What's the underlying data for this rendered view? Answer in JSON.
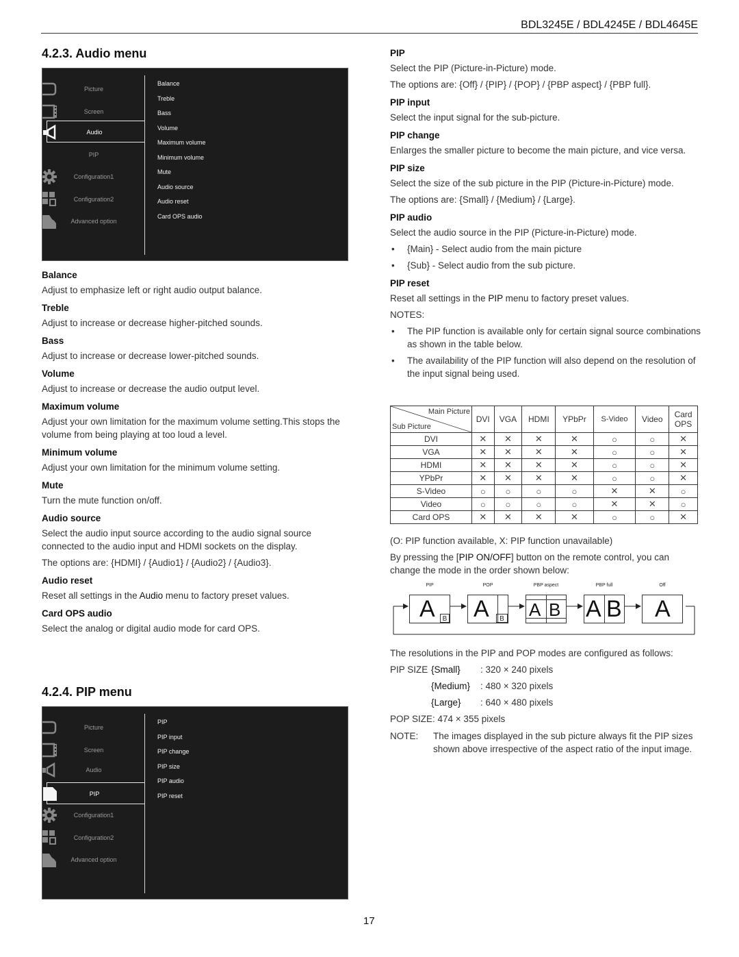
{
  "header": {
    "models": "BDL3245E / BDL4245E / BDL4645E"
  },
  "audio_section": {
    "title": "4.2.3.  Audio menu",
    "osd": {
      "left_items": [
        {
          "label": "Picture",
          "icon": "monitor-icon",
          "selected": false
        },
        {
          "label": "Screen",
          "icon": "film-screen-icon",
          "selected": false
        },
        {
          "label": "Audio",
          "icon": "speaker-icon",
          "selected": true
        },
        {
          "label": "PIP",
          "icon": "pip-icon",
          "selected": false
        },
        {
          "label": "Configuration1",
          "icon": "gear-icon",
          "selected": false
        },
        {
          "label": "Configuration2",
          "icon": "grid-icon",
          "selected": false
        },
        {
          "label": "Advanced option",
          "icon": "advanced-icon",
          "selected": false
        }
      ],
      "sub_items": [
        "Balance",
        "Treble",
        "Bass",
        "Volume",
        "Maximum volume",
        "Minimum volume",
        "Mute",
        "Audio source",
        "Audio reset",
        "Card OPS audio"
      ]
    },
    "entries": [
      {
        "heading": "Balance",
        "text": "Adjust to emphasize left or right audio output balance."
      },
      {
        "heading": "Treble",
        "text": "Adjust to increase or decrease higher-pitched sounds."
      },
      {
        "heading": "Bass",
        "text": "Adjust to increase or decrease lower-pitched sounds."
      },
      {
        "heading": "Volume",
        "text": "Adjust to increase or decrease the audio output level."
      },
      {
        "heading": "Maximum volume",
        "text": "Adjust your own limitation for the maximum volume setting.This stops the volume from being playing at too loud a level."
      },
      {
        "heading": "Minimum volume",
        "text": "Adjust your own limitation for the minimum volume setting."
      },
      {
        "heading": "Mute",
        "text": "Turn the mute function on/off."
      },
      {
        "heading": "Audio source",
        "text": "Select the audio input source according to the audio signal source connected to the audio input and HDMI sockets on the display.",
        "options": "The options are: {HDMI} / {Audio1} / {Audio2} / {Audio3}."
      },
      {
        "heading": "Audio reset",
        "text_pre": "Reset all settings in the ",
        "text_key": "Audio",
        "text_post": " menu to factory preset values."
      },
      {
        "heading": "Card OPS audio",
        "text": "Select the analog or digital audio mode for card OPS."
      }
    ]
  },
  "pip_section": {
    "title": "4.2.4.  PIP menu",
    "osd": {
      "left_items": [
        {
          "label": "Picture",
          "icon": "monitor-icon",
          "selected": false
        },
        {
          "label": "Screen",
          "icon": "film-screen-icon",
          "selected": false
        },
        {
          "label": "Audio",
          "icon": "speaker-icon",
          "selected": false
        },
        {
          "label": "PIP",
          "icon": "pip-icon",
          "selected": true
        },
        {
          "label": "Configuration1",
          "icon": "gear-icon",
          "selected": false
        },
        {
          "label": "Configuration2",
          "icon": "grid-icon",
          "selected": false
        },
        {
          "label": "Advanced option",
          "icon": "advanced-icon",
          "selected": false
        }
      ],
      "sub_items": [
        "PIP",
        "PIP input",
        "PIP change",
        "PIP size",
        "PIP audio",
        "PIP reset"
      ]
    },
    "entries": [
      {
        "heading": "PIP",
        "text": "Select the PIP (Picture-in-Picture) mode.",
        "options": "The options are: {Off} / {PIP} / {POP} / {PBP aspect} / {PBP full}."
      },
      {
        "heading": "PIP input",
        "text": "Select the input signal for the sub-picture."
      },
      {
        "heading": "PIP change",
        "text": "Enlarges the smaller picture to become the main picture, and vice versa."
      },
      {
        "heading": "PIP size",
        "text": "Select the size of the sub picture in the PIP (Picture-in-Picture) mode.",
        "options": "The options are: {Small} / {Medium} / {Large}."
      },
      {
        "heading": "PIP audio",
        "text": "Select the audio source in the PIP (Picture-in-Picture) mode.",
        "bullets": [
          "{Main} - Select audio from the main picture",
          "{Sub} - Select audio from the sub picture."
        ]
      },
      {
        "heading": "PIP reset",
        "text_pre": "Reset all settings in the ",
        "text_key": "PIP",
        "text_post": " menu to factory preset values."
      }
    ],
    "notes_label": "NOTES:",
    "notes": [
      "The PIP function is available only for certain signal source combinations as shown in the table below.",
      "The availability of the PIP function will also depend on the resolution of the input signal being used."
    ],
    "table": {
      "corner_main": "Main Picture",
      "corner_sub": "Sub Picture",
      "columns": [
        "DVI",
        "VGA",
        "HDMI",
        "YPbPr",
        "S-Video",
        "Video",
        "Card OPS"
      ],
      "rows": [
        {
          "label": "DVI",
          "cells": [
            "X",
            "X",
            "X",
            "X",
            "O",
            "O",
            "X"
          ]
        },
        {
          "label": "VGA",
          "cells": [
            "X",
            "X",
            "X",
            "X",
            "O",
            "O",
            "X"
          ]
        },
        {
          "label": "HDMI",
          "cells": [
            "X",
            "X",
            "X",
            "X",
            "O",
            "O",
            "X"
          ]
        },
        {
          "label": "YPbPr",
          "cells": [
            "X",
            "X",
            "X",
            "X",
            "O",
            "O",
            "X"
          ]
        },
        {
          "label": "S-Video",
          "cells": [
            "O",
            "O",
            "O",
            "O",
            "X",
            "X",
            "O"
          ]
        },
        {
          "label": "Video",
          "cells": [
            "O",
            "O",
            "O",
            "O",
            "X",
            "X",
            "O"
          ]
        },
        {
          "label": "Card OPS",
          "cells": [
            "X",
            "X",
            "X",
            "X",
            "O",
            "O",
            "X"
          ]
        }
      ]
    },
    "legend": "(O: PIP function available, X: PIP function unavailable)",
    "remote_pre": "By pressing the [",
    "remote_key": "PIP ON/OFF",
    "remote_post": "] button on the remote control, you can change the mode in the order shown below:",
    "flow": [
      {
        "label": "PIP",
        "main": "A",
        "sub": "B"
      },
      {
        "label": "POP",
        "main": "A",
        "sub": "B"
      },
      {
        "label": "PBP aspect",
        "main": "A",
        "sub": "B"
      },
      {
        "label": "PBP full",
        "main": "A",
        "sub": "B"
      },
      {
        "label": "Off",
        "main": "A",
        "sub": ""
      }
    ],
    "resolutions_intro": "The resolutions in the PIP and POP modes are configured as follows:",
    "pip_size_label": "PIP SIZE",
    "pip_sizes": [
      {
        "name": "{Small}",
        "value": ": 320 × 240 pixels"
      },
      {
        "name": "{Medium}",
        "value": ": 480 × 320 pixels"
      },
      {
        "name": "{Large}",
        "value": ": 640 × 480 pixels"
      }
    ],
    "pop_size": "POP SIZE: 474 × 355 pixels",
    "note_label": "NOTE:",
    "note_text": "The images displayed in the sub picture always fit the PIP sizes shown above irrespective of the aspect ratio of the input image."
  },
  "page_number": "17"
}
